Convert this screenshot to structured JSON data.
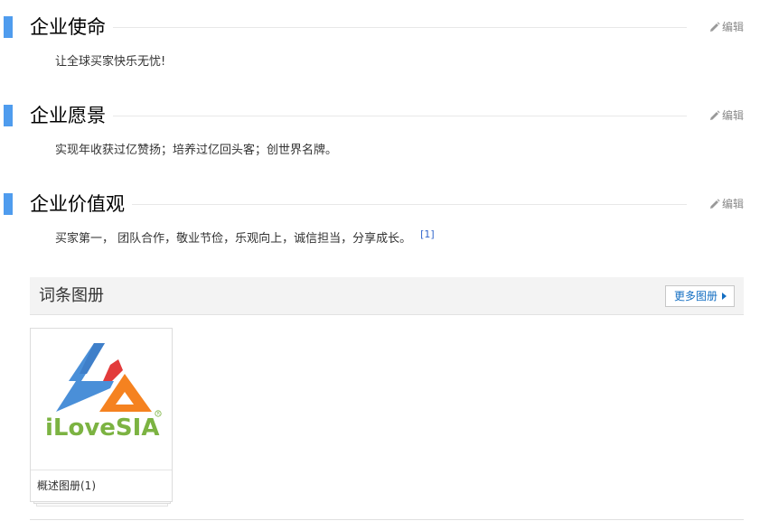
{
  "sections": [
    {
      "title": "企业使命",
      "edit_label": "编辑",
      "body": "让全球买家快乐无忧!"
    },
    {
      "title": "企业愿景",
      "edit_label": "编辑",
      "body": "实现年收获过亿赞扬；培养过亿回头客；创世界名牌。"
    },
    {
      "title": "企业价值观",
      "edit_label": "编辑",
      "body": "买家第一， 团队合作，敬业节俭，乐观向上，诚信担当，分享成长。",
      "ref": "[1]"
    }
  ],
  "album": {
    "title": "词条图册",
    "more_label": "更多图册",
    "cards": [
      {
        "logo_text": "iLoveSIA",
        "caption": "概述图册(1)"
      }
    ]
  },
  "colors": {
    "section_bar": "#4f9cee",
    "link": "#136ec2",
    "logo_blue": "#4a8fd8",
    "logo_red": "#e23b3b",
    "logo_orange": "#f58220",
    "logo_green": "#7cb342"
  },
  "icons": {
    "edit": "pencil-icon",
    "more": "arrow-right-icon"
  }
}
